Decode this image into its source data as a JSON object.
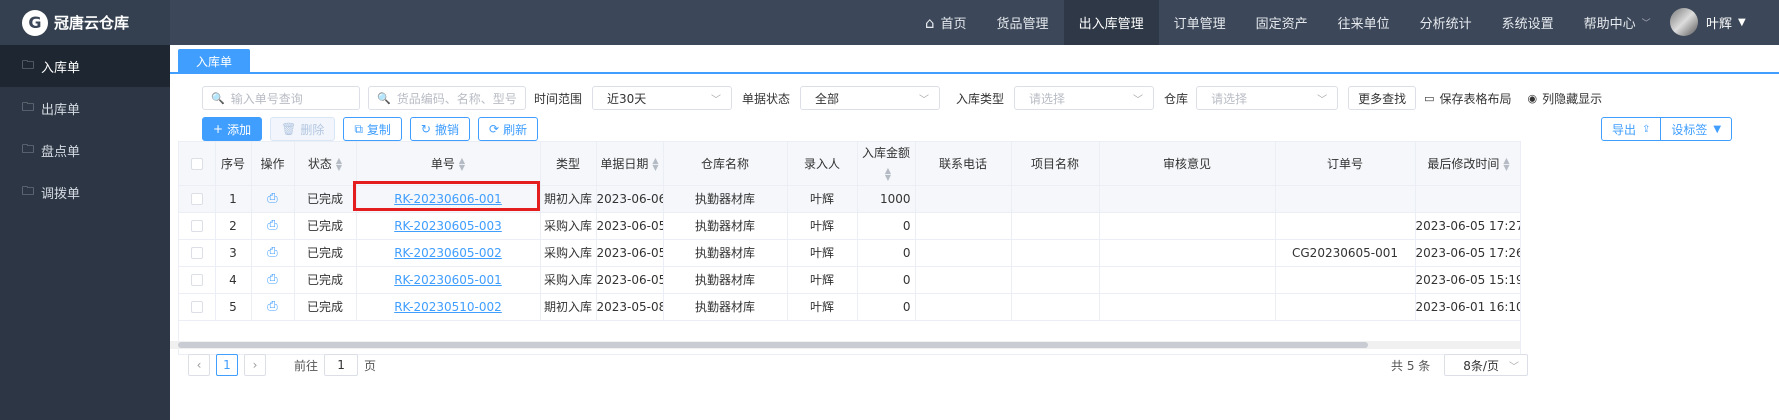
{
  "app": {
    "logo_mark": "G",
    "title": "冠唐云仓库"
  },
  "topnav": {
    "items": [
      {
        "label": "首页",
        "icon": "home-icon"
      },
      {
        "label": "货品管理"
      },
      {
        "label": "出入库管理",
        "active": true
      },
      {
        "label": "订单管理"
      },
      {
        "label": "固定资产"
      },
      {
        "label": "往来单位"
      },
      {
        "label": "分析统计"
      },
      {
        "label": "系统设置"
      },
      {
        "label": "帮助中心",
        "has_dropdown": true
      }
    ],
    "user_name": "叶辉"
  },
  "sidebar": {
    "items": [
      {
        "label": "入库单",
        "active": true
      },
      {
        "label": "出库单"
      },
      {
        "label": "盘点单"
      },
      {
        "label": "调拨单"
      }
    ]
  },
  "tabs": [
    {
      "label": "入库单"
    }
  ],
  "filters": {
    "doc_search_placeholder": "输入单号查询",
    "item_search_placeholder": "货品编码、名称、型号",
    "time_range_label": "时间范围",
    "time_range_value": "近30天",
    "doc_status_label": "单据状态",
    "doc_status_value": "全部",
    "in_type_label": "入库类型",
    "in_type_placeholder": "请选择",
    "warehouse_label": "仓库",
    "warehouse_placeholder": "请选择",
    "more_search": "更多查找",
    "save_layout": "保存表格布局",
    "column_visibility": "列隐藏显示"
  },
  "actions": {
    "add": "添加",
    "delete": "删除",
    "copy": "复制",
    "revoke": "撤销",
    "refresh": "刷新",
    "export": "导出",
    "set_label": "设标签"
  },
  "table": {
    "headers": [
      "序号",
      "操作",
      "状态",
      "单号",
      "类型",
      "单据日期",
      "仓库名称",
      "录入人",
      "入库金额",
      "联系电话",
      "项目名称",
      "审核意见",
      "订单号",
      "最后修改时间"
    ],
    "rows": [
      {
        "no": "1",
        "status": "已完成",
        "doc_no": "RK-20230606-001",
        "type": "期初入库",
        "date": "2023-06-06",
        "warehouse": "执勤器材库",
        "entered_by": "叶辉",
        "amount": "1000",
        "phone": "",
        "project": "",
        "review": "",
        "order_no": "",
        "modified": ""
      },
      {
        "no": "2",
        "status": "已完成",
        "doc_no": "RK-20230605-003",
        "type": "采购入库",
        "date": "2023-06-05",
        "warehouse": "执勤器材库",
        "entered_by": "叶辉",
        "amount": "0",
        "phone": "",
        "project": "",
        "review": "",
        "order_no": "",
        "modified": "2023-06-05 17:27:3"
      },
      {
        "no": "3",
        "status": "已完成",
        "doc_no": "RK-20230605-002",
        "type": "采购入库",
        "date": "2023-06-05",
        "warehouse": "执勤器材库",
        "entered_by": "叶辉",
        "amount": "0",
        "phone": "",
        "project": "",
        "review": "",
        "order_no": "CG20230605-001",
        "modified": "2023-06-05 17:26:2"
      },
      {
        "no": "4",
        "status": "已完成",
        "doc_no": "RK-20230605-001",
        "type": "采购入库",
        "date": "2023-06-05",
        "warehouse": "执勤器材库",
        "entered_by": "叶辉",
        "amount": "0",
        "phone": "",
        "project": "",
        "review": "",
        "order_no": "",
        "modified": "2023-06-05 15:19:1"
      },
      {
        "no": "5",
        "status": "已完成",
        "doc_no": "RK-20230510-002",
        "type": "期初入库",
        "date": "2023-05-08",
        "warehouse": "执勤器材库",
        "entered_by": "叶辉",
        "amount": "0",
        "phone": "",
        "project": "",
        "review": "",
        "order_no": "",
        "modified": "2023-06-01 16:10:4"
      }
    ]
  },
  "pagination": {
    "current_page": "1",
    "goto_prefix": "前往",
    "goto_value": "1",
    "goto_suffix": "页",
    "total": "共 5 条",
    "page_size": "8条/页"
  },
  "colors": {
    "accent": "#409eff",
    "topbar": "#3c4859",
    "sidebar": "#2c3644",
    "highlight_box": "#e41e1e"
  }
}
